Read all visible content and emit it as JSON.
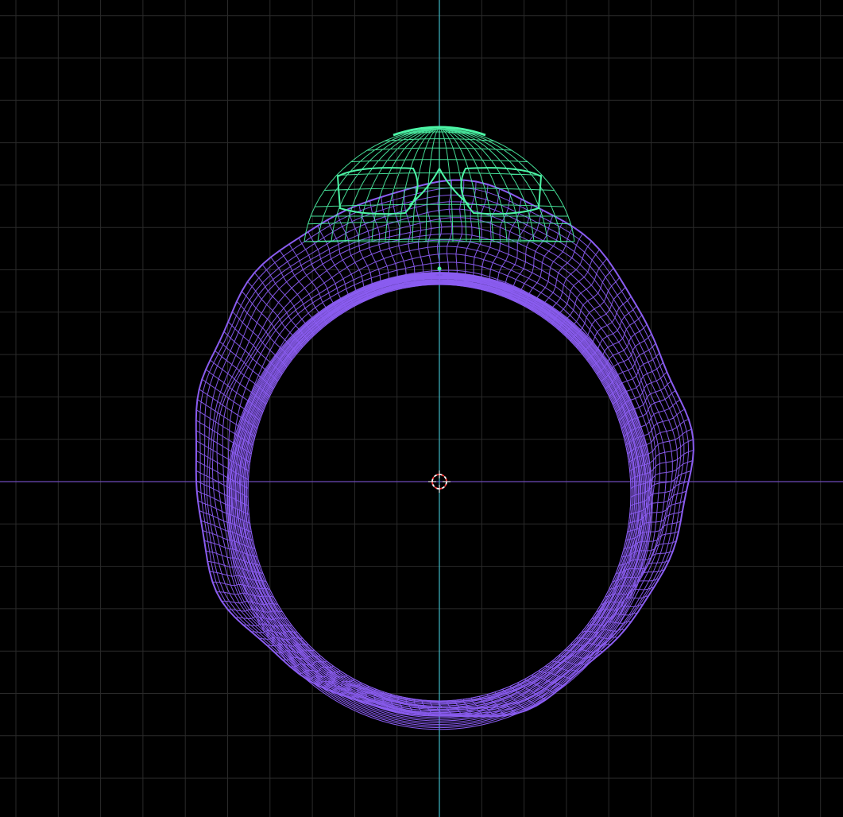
{
  "viewport": {
    "view": "orthographic-front",
    "mode": "wireframe"
  },
  "scene": {
    "objects": [
      {
        "name": "ring-band",
        "selected": false
      },
      {
        "name": "skull-head",
        "selected": true
      }
    ]
  },
  "colors": {
    "background": "#000000",
    "grid": "#2a2a2a",
    "axis_x": "#6e4ab8",
    "axis_z": "#3fb8c4",
    "wire_unselected": "#8a5cf0",
    "wire_selected": "#4cf5a6",
    "origin_marker": "#4cf5a6",
    "cursor_red": "#ff3a3a",
    "cursor_white": "#ffffff"
  },
  "icons": {
    "cursor": "3d-cursor-icon",
    "origin": "object-origin-icon"
  }
}
